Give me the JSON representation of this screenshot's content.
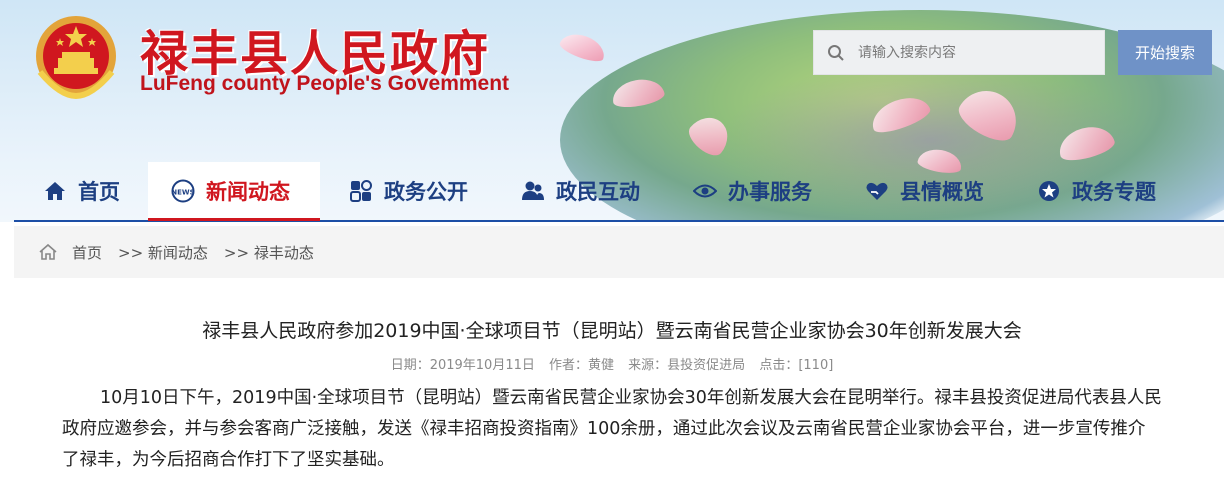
{
  "header": {
    "title": "禄丰县人民政府",
    "subtitle": "LuFeng county People's Govemment",
    "search": {
      "placeholder": "请输入搜索内容",
      "button_label": "开始搜索"
    }
  },
  "nav": {
    "items": [
      {
        "label": "首页",
        "icon": "home-icon"
      },
      {
        "label": "新闻动态",
        "icon": "news-icon",
        "active": true
      },
      {
        "label": "政务公开",
        "icon": "grid-icon"
      },
      {
        "label": "政民互动",
        "icon": "people-icon"
      },
      {
        "label": "办事服务",
        "icon": "eye-icon"
      },
      {
        "label": "县情概览",
        "icon": "heart-hand-icon"
      },
      {
        "label": "政务专题",
        "icon": "star-icon"
      }
    ]
  },
  "breadcrumb": {
    "items": [
      "首页",
      ">> 新闻动态",
      ">> 禄丰动态"
    ]
  },
  "article": {
    "title": "禄丰县人民政府参加2019中国·全球项目节（昆明站）暨云南省民营企业家协会30年创新发展大会",
    "meta": {
      "date": "日期：2019年10月11日",
      "author": "作者：黄健",
      "source": "来源：县投资促进局",
      "clicks": "点击：[110]"
    },
    "body": "10月10日下午，2019中国·全球项目节（昆明站）暨云南省民营企业家协会30年创新发展大会在昆明举行。禄丰县投资促进局代表县人民政府应邀参会，并与参会客商广泛接触，发送《禄丰招商投资指南》100余册，通过此次会议及云南省民营企业家协会平台，进一步宣传推介了禄丰，为今后招商合作打下了坚实基础。"
  },
  "colors": {
    "brand_red": "#d0171f",
    "nav_blue": "#1d3f82",
    "button_blue": "#6f92c7"
  }
}
